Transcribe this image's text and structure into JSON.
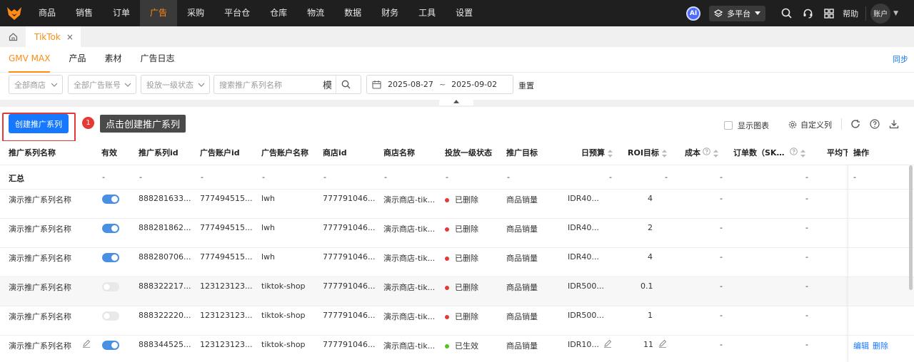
{
  "nav": {
    "items": [
      "商品",
      "销售",
      "订单",
      "广告",
      "采购",
      "平台仓",
      "仓库",
      "物流",
      "数据",
      "财务",
      "工具",
      "设置"
    ],
    "active": "广告",
    "ai_label": "AI",
    "platform_label": "多平台",
    "help_label": "帮助",
    "account_label": "账户"
  },
  "tabs": {
    "home_icon": "home-icon",
    "open_tab": "TikTok",
    "close_glyph": "×"
  },
  "subtabs": {
    "items": [
      "GMV MAX",
      "产品",
      "素材",
      "广告日志"
    ],
    "active": "GMV MAX",
    "sync_label": "同步"
  },
  "filters": {
    "shop_placeholder": "全部商店",
    "ad_account_placeholder": "全部广告账号",
    "status_placeholder": "投放一级状态",
    "search_placeholder": "搜索推广系列名称",
    "search_mode": "模",
    "date_start": "2025-08-27",
    "date_sep": "~",
    "date_end": "2025-09-02",
    "reset_label": "重置"
  },
  "toolbar": {
    "create_label": "创建推广系列",
    "step_number": "1",
    "tip_text": "点击创建推广系列",
    "show_chart_label": "显示图表",
    "custom_columns_label": "自定义列"
  },
  "table": {
    "headers": {
      "name": "推广系列名称",
      "enabled": "有效",
      "campaign_id": "推广系列id",
      "ad_account_id": "广告账户id",
      "ad_account_name": "广告账户名称",
      "shop_id": "商店id",
      "shop_name": "商店名称",
      "status": "投放一级状态",
      "goal": "推广目标",
      "budget": "日预算",
      "roi": "ROI目标",
      "cost": "成本",
      "orders": "订单数（SK…",
      "avg": "平均下",
      "ops": "操作"
    },
    "summary": {
      "label": "汇总",
      "dash": "-"
    },
    "rows": [
      {
        "name": "演示推广系列名称",
        "enabled": true,
        "campaign_id": "888281633...",
        "ad_account_id": "777494515...",
        "ad_account_name": "lwh",
        "shop_id": "777791046...",
        "shop_name": "演示商店-tik...",
        "status": "已删除",
        "status_color": "#e53935",
        "goal": "商品销量",
        "budget": "IDR40...",
        "roi": "4",
        "cost": "-",
        "orders": "-",
        "edit": "",
        "delete": ""
      },
      {
        "name": "演示推广系列名称",
        "enabled": true,
        "campaign_id": "888281862...",
        "ad_account_id": "777494515...",
        "ad_account_name": "lwh",
        "shop_id": "777791046...",
        "shop_name": "演示商店-tik...",
        "status": "已删除",
        "status_color": "#e53935",
        "goal": "商品销量",
        "budget": "IDR40...",
        "roi": "2",
        "cost": "-",
        "orders": "-",
        "edit": "",
        "delete": ""
      },
      {
        "name": "演示推广系列名称",
        "enabled": true,
        "campaign_id": "888280706...",
        "ad_account_id": "777494515...",
        "ad_account_name": "lwh",
        "shop_id": "777791046...",
        "shop_name": "演示商店-tik...",
        "status": "已删除",
        "status_color": "#e53935",
        "goal": "商品销量",
        "budget": "IDR40...",
        "roi": "4",
        "cost": "-",
        "orders": "-",
        "edit": "",
        "delete": ""
      },
      {
        "name": "演示推广系列名称",
        "enabled": false,
        "campaign_id": "888322217...",
        "ad_account_id": "123123123...",
        "ad_account_name": "tiktok-shop",
        "shop_id": "777791046...",
        "shop_name": "演示商店-tik...",
        "status": "已删除",
        "status_color": "#e53935",
        "goal": "商品销量",
        "budget": "IDR500...",
        "roi": "0.1",
        "cost": "-",
        "orders": "-",
        "edit": "",
        "delete": ""
      },
      {
        "name": "演示推广系列名称",
        "enabled": false,
        "campaign_id": "888322220...",
        "ad_account_id": "123123123...",
        "ad_account_name": "tiktok-shop",
        "shop_id": "777791046...",
        "shop_name": "演示商店-tik...",
        "status": "已删除",
        "status_color": "#e53935",
        "goal": "商品销量",
        "budget": "IDR500...",
        "roi": "1",
        "cost": "-",
        "orders": "-",
        "edit": "",
        "delete": ""
      },
      {
        "name": "演示推广系列名称",
        "enabled": true,
        "campaign_id": "888344525...",
        "ad_account_id": "123123123...",
        "ad_account_name": "tiktok-shop",
        "shop_id": "777791046...",
        "shop_name": "演示商店-tik...",
        "status": "已生效",
        "status_color": "#52c41a",
        "goal": "商品销量",
        "budget": "IDR10...",
        "roi": "11",
        "cost": "-",
        "orders": "-",
        "edit": "编辑",
        "delete": "删除"
      }
    ]
  },
  "colors": {
    "accent": "#ff8a14",
    "primary": "#1677ff",
    "danger": "#e53935",
    "success": "#52c41a",
    "nav_bg": "#1f1f1f"
  }
}
